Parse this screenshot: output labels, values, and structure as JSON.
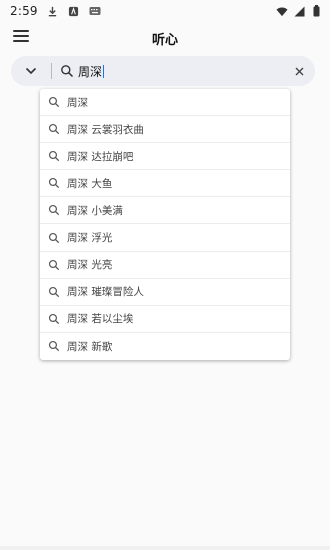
{
  "status_bar": {
    "time": "2:59",
    "left_icons": [
      "download-icon",
      "app-notification-icon",
      "keyboard-icon"
    ],
    "right_icons": [
      "wifi-icon",
      "signal-icon",
      "battery-icon"
    ]
  },
  "app_bar": {
    "title": "听心",
    "menu_icon": "hamburger-menu-icon"
  },
  "search": {
    "query": "周深",
    "collapse_icon": "chevron-down-icon",
    "search_icon": "search-icon",
    "clear_icon": "close-icon"
  },
  "suggestions": [
    {
      "label": "周深"
    },
    {
      "label": "周深 云裳羽衣曲"
    },
    {
      "label": "周深 达拉崩吧"
    },
    {
      "label": "周深 大鱼"
    },
    {
      "label": "周深 小美满"
    },
    {
      "label": "周深 浮光"
    },
    {
      "label": "周深 光亮"
    },
    {
      "label": "周深 璀璨冒险人"
    },
    {
      "label": "周深 若以尘埃"
    },
    {
      "label": "周深 新歌"
    }
  ],
  "colors": {
    "background": "#fafafa",
    "search_bar_bg": "#eceef3",
    "text": "#202124",
    "caret": "#1a73e8"
  }
}
